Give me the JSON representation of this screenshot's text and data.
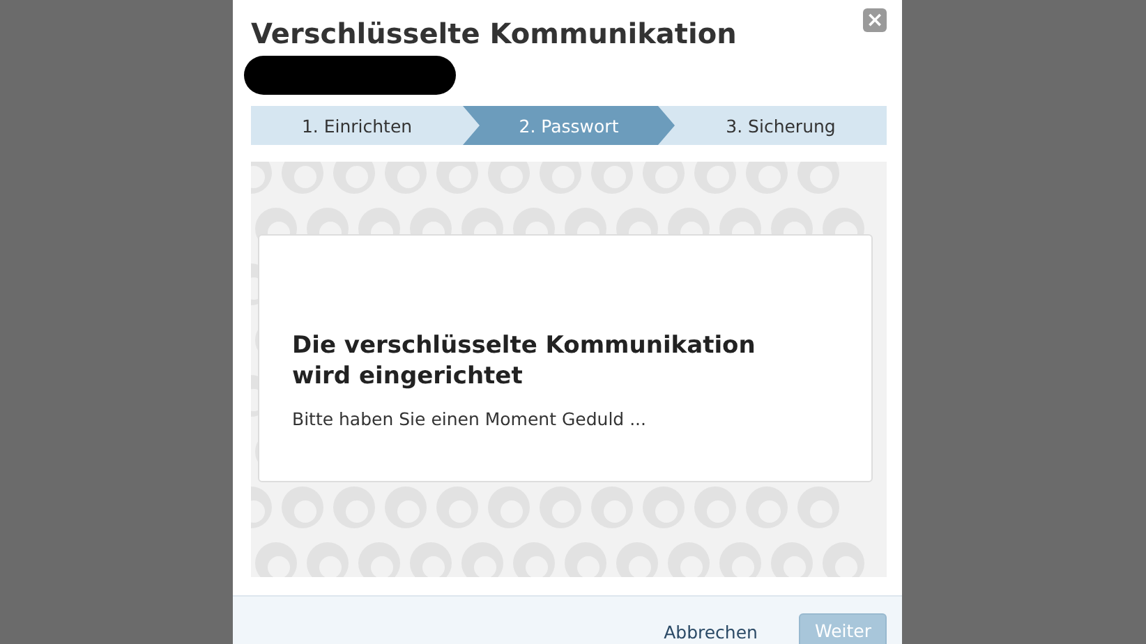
{
  "dialog": {
    "title": "Verschlüsselte Kommunikation",
    "close_icon": "×",
    "steps": [
      {
        "label": "1. Einrichten",
        "selected": false
      },
      {
        "label": "2. Passwort",
        "selected": true
      },
      {
        "label": "3. Sicherung",
        "selected": false
      }
    ],
    "message": {
      "heading": "Die verschlüsselte Kommunikation wird eingerichtet",
      "text": "Bitte haben Sie einen Moment Geduld ..."
    },
    "buttons": [
      {
        "label": "Abbrechen",
        "kind": "link",
        "disabled": false
      },
      {
        "label": "Weiter",
        "kind": "primary",
        "disabled": true
      }
    ]
  }
}
